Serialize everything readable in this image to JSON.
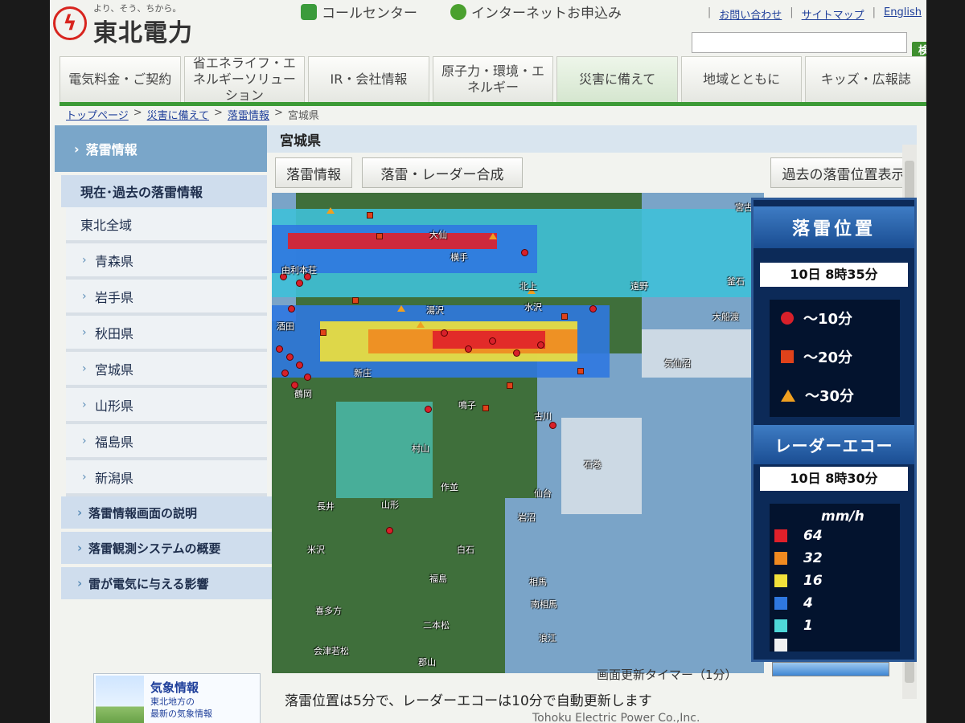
{
  "header": {
    "logo_tagline": "より、そう、ちから。",
    "logo_name": "東北電力",
    "call_center": "コールセンター",
    "internet_apply": "インターネットお申込み",
    "util_links": [
      "お問い合わせ",
      "サイトマップ",
      "English"
    ],
    "search_placeholder": "",
    "search_button": "検索"
  },
  "nav": {
    "items": [
      "電気料金・ご契約",
      "省エネライフ・エネルギーソリューション",
      "IR・会社情報",
      "原子力・環境・エネルギー",
      "災害に備えて",
      "地域とともに",
      "キッズ・広報誌"
    ]
  },
  "breadcrumb": [
    "トップページ",
    "災害に備えて",
    "落雷情報",
    "宮城県"
  ],
  "sidebar": {
    "heading": "落雷情報",
    "sub_heading": "現在･過去の落雷情報",
    "items": [
      "東北全域",
      "青森県",
      "岩手県",
      "秋田県",
      "宮城県",
      "山形県",
      "福島県",
      "新潟県"
    ],
    "links": [
      "落雷情報画面の説明",
      "落雷観測システムの概要",
      "雷が電気に与える影響"
    ],
    "banner": {
      "title": "気象情報",
      "text_line1": "東北地方の",
      "text_line2": "最新の気象情報"
    }
  },
  "main": {
    "title": "宮城県",
    "tab_lightning": "落雷情報",
    "tab_radar": "落雷・レーダー合成",
    "past_button": "過去の落雷位置表示",
    "timer_label": "画面更新タイマー（1分）",
    "footer_note": "落雷位置は5分で、レーダーエコーは10分で自動更新します",
    "copyright": "Tohoku Electric Power Co.,Inc."
  },
  "map": {
    "places": [
      "宮古",
      "大仙",
      "横手",
      "由利本荘",
      "北上",
      "遠野",
      "釜石",
      "水沢",
      "湯沢",
      "大船渡",
      "酒田",
      "新庄",
      "気仙沼",
      "鶴岡",
      "鳴子",
      "古川",
      "村山",
      "石巻",
      "作並",
      "仙台",
      "長井",
      "山形",
      "岩沼",
      "米沢",
      "白石",
      "福島",
      "相馬",
      "南相馬",
      "喜多方",
      "二本松",
      "浪江",
      "会津若松",
      "郡山"
    ]
  },
  "legend": {
    "title": "落雷位置",
    "lightning_time": "10日 8時35分",
    "ranges": [
      "～10分",
      "～20分",
      "～30分"
    ],
    "radar_title": "レーダーエコー",
    "radar_time": "10日 8時30分",
    "unit": "mm/h",
    "levels": [
      "64",
      "32",
      "16",
      "4",
      "1"
    ],
    "level_colors": [
      "#e0202a",
      "#f08a20",
      "#f2e13a",
      "#2f78e0",
      "#4fd8d8",
      "#f0f0f0"
    ]
  }
}
